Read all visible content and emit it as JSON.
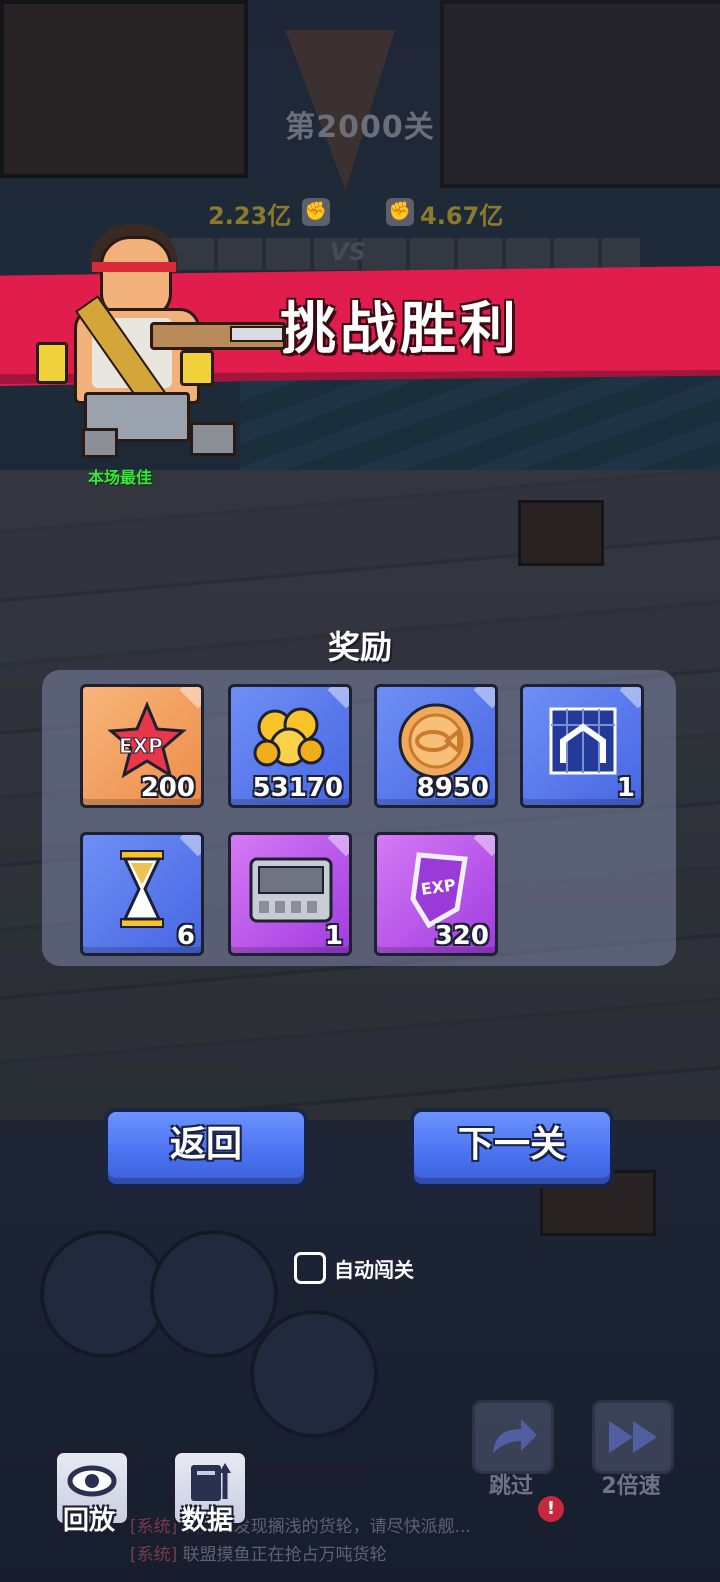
{
  "stage": {
    "title": "第2000关",
    "our_power": "2.23亿",
    "enemy_power": "4.67亿",
    "vs": "VS"
  },
  "result": {
    "title": "挑战胜利",
    "mvp_label": "本场最佳"
  },
  "rewards": {
    "title": "奖励",
    "items": [
      {
        "icon": "exp-star-icon",
        "qty": "200",
        "rarity": "orange"
      },
      {
        "icon": "gold-nuggets-icon",
        "qty": "53170",
        "rarity": "blue"
      },
      {
        "icon": "fish-coin-icon",
        "qty": "8950",
        "rarity": "blue"
      },
      {
        "icon": "blueprint-icon",
        "qty": "1",
        "rarity": "blue"
      },
      {
        "icon": "hourglass-icon",
        "qty": "6",
        "rarity": "blue"
      },
      {
        "icon": "game-cartridge-icon",
        "qty": "1",
        "rarity": "purple"
      },
      {
        "icon": "exp-badge-icon",
        "qty": "320",
        "rarity": "purple"
      }
    ]
  },
  "buttons": {
    "back": "返回",
    "next": "下一关"
  },
  "auto": {
    "label": "自动闯关",
    "checked": false
  },
  "toolbar": {
    "replay": "回放",
    "data": "数据",
    "skip": "跳过",
    "speed": "2倍速"
  },
  "chat": [
    {
      "tag": "[系统]",
      "text": "城附近发现搁浅的货轮，请尽快派舰..."
    },
    {
      "tag": "[系统]",
      "text": "联盟摸鱼正在抢占万吨货轮"
    }
  ],
  "colors": {
    "banner": "#e11d4d",
    "button": "#4a72f0",
    "mvp": "#38e63a"
  }
}
